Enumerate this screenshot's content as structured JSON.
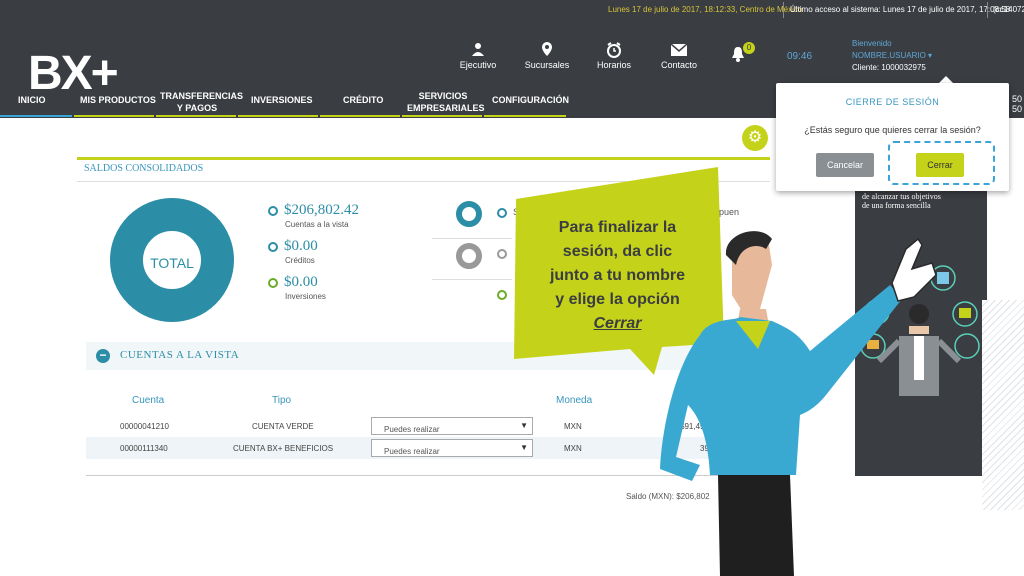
{
  "topbar": {
    "datetime": "Lunes 17 de julio de 2017, 18:12:33, Centro de México",
    "last_access": "Último acceso al sistema: Lunes 17 de julio de 2017, 17:08:58",
    "code": "(cc14072"
  },
  "header": {
    "logo": "BX+",
    "icons": [
      {
        "label": "Ejecutivo",
        "icon": "person-icon"
      },
      {
        "label": "Sucursales",
        "icon": "location-pin-icon"
      },
      {
        "label": "Horarios",
        "icon": "alarm-clock-icon"
      },
      {
        "label": "Contacto",
        "icon": "envelope-icon"
      }
    ],
    "notifications": "0",
    "time": "09:46",
    "user": {
      "greeting": "Bienvenido",
      "name": "NOMBRE.USUARIO ▾",
      "client": "Cliente: 1000032975"
    }
  },
  "nav": {
    "items": [
      "INICIO",
      "MIS PRODUCTOS",
      "TRANSFERENCIAS\nY PAGOS",
      "INVERSIONES",
      "CRÉDITO",
      "SERVICIOS\nEMPRESARIALES",
      "CONFIGURACIÓN"
    ]
  },
  "summary": {
    "title": "SALDOS CONSOLIDADOS",
    "donut_label": "TOTAL",
    "balances": [
      {
        "amount": "$206,802.42",
        "label": "Cuentas a la vista"
      },
      {
        "amount": "$0.00",
        "label": "Créditos"
      },
      {
        "amount": "$0.00",
        "label": "Inversiones"
      }
    ],
    "partial_a": "Sa",
    "partial_b": "puen"
  },
  "accounts": {
    "section_title": "CUENTAS A LA VISTA",
    "headers": [
      "Cuenta",
      "Tipo",
      "Moneda"
    ],
    "rows": [
      {
        "account": "00000041210",
        "type": "CUENTA VERDE",
        "action": "Puedes realizar",
        "currency": "MXN",
        "balance": "$91,494"
      },
      {
        "account": "00000111340",
        "type": "CUENTA BX+ BENEFICIOS",
        "action": "Puedes realizar",
        "currency": "MXN",
        "balance": "398"
      }
    ],
    "total": "Saldo (MXN): $206,802"
  },
  "logout_popup": {
    "title": "CIERRE DE SESIÓN",
    "question": "¿Estás seguro que quieres cerrar la sesión?",
    "cancel": "Cancelar",
    "confirm": "Cerrar"
  },
  "ad": {
    "text": "de alcanzar tus objetivos\nde una forma sencilla"
  },
  "edge": {
    "t1": "50",
    "t2": "50"
  },
  "tutorial": {
    "line1": "Para finalizar la",
    "line2": "sesión, da clic",
    "line3": "junto a tu nombre",
    "line4": "y elige la opción",
    "emph": "Cerrar"
  },
  "colors": {
    "accent": "#c5d21a",
    "primary": "#2c8ea6",
    "dark": "#3a3d42",
    "link": "#3aa3d8"
  }
}
